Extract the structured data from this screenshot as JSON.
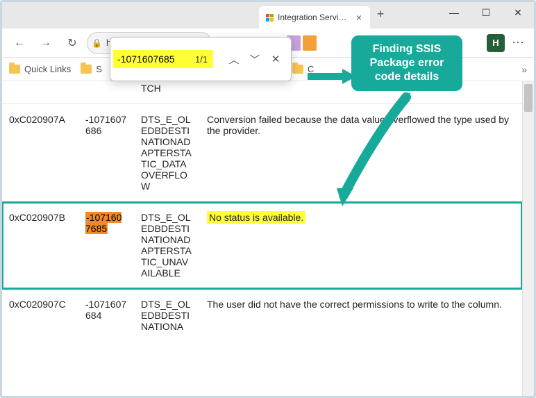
{
  "window": {
    "tab_title": "Integration Services",
    "profile_initial": "H"
  },
  "address": {
    "url": "https://docs...."
  },
  "bookmarks": {
    "item0": "Quick Links",
    "item1": "S",
    "item2": "C"
  },
  "find": {
    "query": "-1071607685",
    "count": "1/1"
  },
  "callout": {
    "text": "Finding SSIS Package error code details"
  },
  "color_chips": [
    "#c9a0dc",
    "#f4a03a",
    "#17a999"
  ],
  "table": {
    "rows": [
      {
        "hex": "",
        "dec": "",
        "name": "TCH",
        "desc": ""
      },
      {
        "hex": "0xC020907A",
        "dec": "-1071607686",
        "name": "DTS_E_OLEDBDESTINATIONADAPTERSTATIC_DATAOVERFLOW",
        "desc": "Conversion failed because the data value overflowed the type used by the provider."
      },
      {
        "hex": "0xC020907B",
        "dec": "-1071607685",
        "name": "DTS_E_OLEDBDESTINATIONADAPTERSTATIC_UNAVAILABLE",
        "desc": "No status is available.",
        "highlight": true
      },
      {
        "hex": "0xC020907C",
        "dec": "-1071607684",
        "name": "DTS_E_OLEDBDESTINATIONA",
        "desc": "The user did not have the correct permissions to write to the column."
      }
    ]
  }
}
